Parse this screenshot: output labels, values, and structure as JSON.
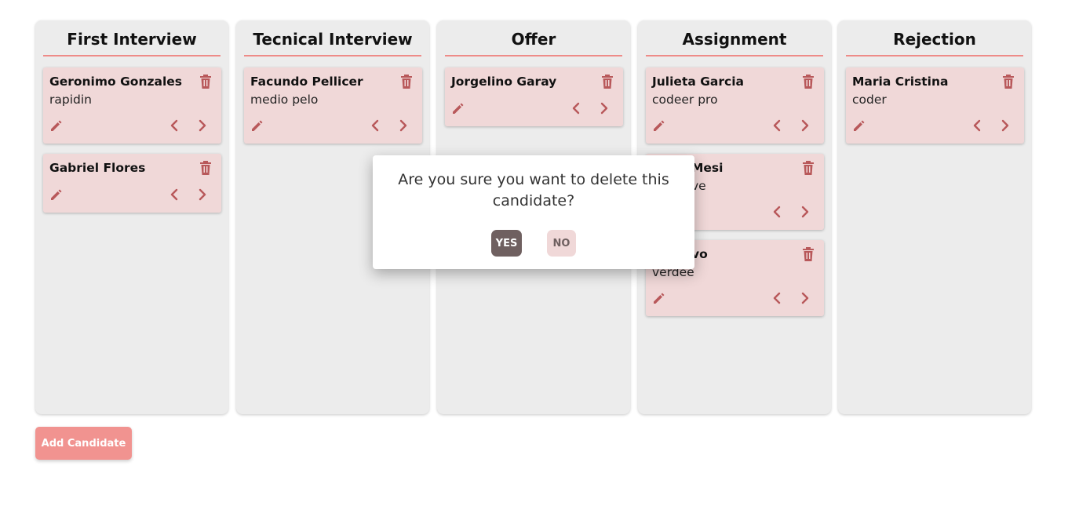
{
  "colors": {
    "accent": "#f19390",
    "card": "#f0d8d8",
    "icon": "#b8585a",
    "underline": "#ee8b88"
  },
  "columns": [
    {
      "title": "First Interview",
      "cards": [
        {
          "name": "Geronimo Gonzales",
          "skill": "rapidin"
        },
        {
          "name": "Gabriel Flores",
          "skill": ""
        }
      ]
    },
    {
      "title": "Tecnical Interview",
      "cards": [
        {
          "name": "Facundo Pellicer",
          "skill": "medio pelo"
        }
      ]
    },
    {
      "title": "Offer",
      "cards": [
        {
          "name": "Jorgelino Garay",
          "skill": ""
        }
      ]
    },
    {
      "title": "Assignment",
      "cards": [
        {
          "name": "Julieta Garcia",
          "skill": "codeer pro"
        },
        {
          "name": "Mesi",
          "skill": "ve"
        },
        {
          "name": "vo",
          "skill": "verdee"
        }
      ]
    },
    {
      "title": "Rejection",
      "cards": [
        {
          "name": "Maria Cristina",
          "skill": "coder"
        }
      ]
    }
  ],
  "add_button": "Add Candidate",
  "modal": {
    "message": "Are you sure you want to delete this candidate?",
    "yes": "YES",
    "no": "NO"
  },
  "icons": {
    "delete": "trash-icon",
    "edit": "pencil-icon",
    "prev": "chevron-left-icon",
    "next": "chevron-right-icon"
  }
}
